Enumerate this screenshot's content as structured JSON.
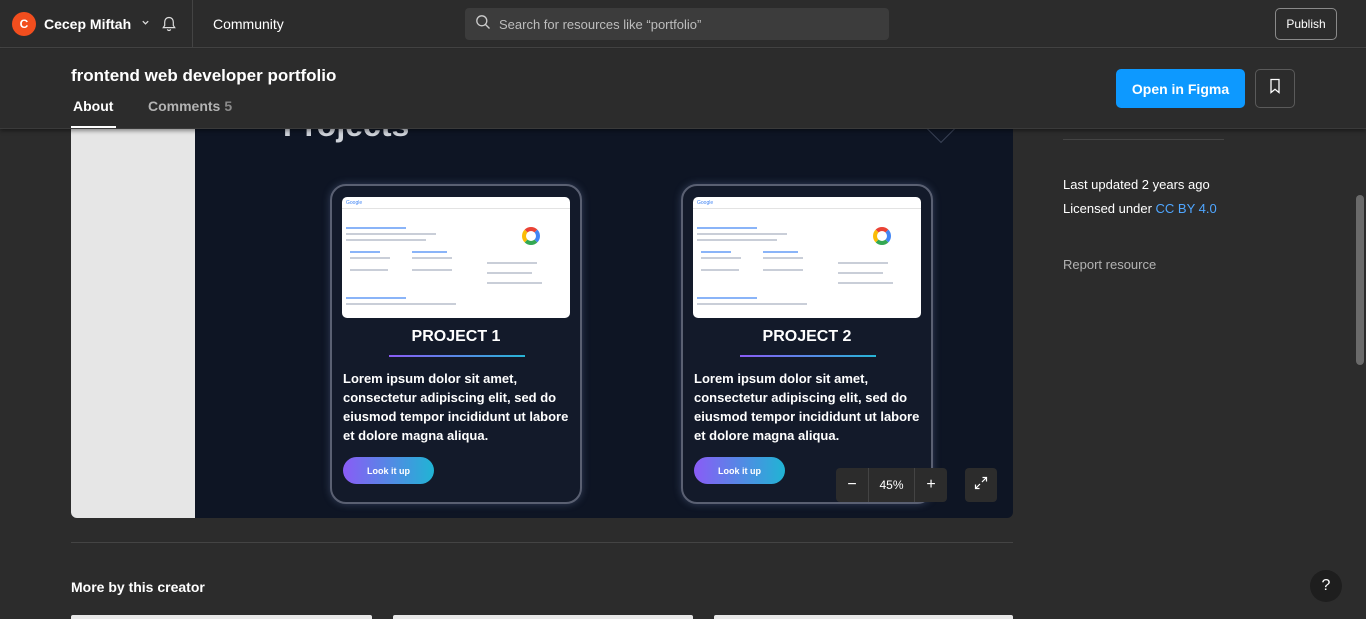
{
  "topbar": {
    "avatar_initial": "C",
    "username": "Cecep Miftah",
    "community_label": "Community",
    "search_placeholder": "Search for resources like “portfolio”",
    "publish_label": "Publish"
  },
  "header": {
    "title": "frontend web developer portfolio",
    "tabs": [
      {
        "label": "About",
        "active": true
      },
      {
        "label": "Comments",
        "count": "5",
        "active": false
      }
    ],
    "open_in_figma_label": "Open in Figma"
  },
  "preview": {
    "heading": "Projects",
    "cards": [
      {
        "title": "PROJECT 1",
        "description": "Lorem ipsum dolor sit amet, consectetur adipiscing elit, sed do eiusmod tempor incididunt ut labore et dolore magna aliqua.",
        "button_label": "Look it up",
        "screenshot_logo": "Google"
      },
      {
        "title": "PROJECT 2",
        "description": "Lorem ipsum dolor sit amet, consectetur adipiscing elit, sed do eiusmod tempor incididunt ut labore et dolore magna aliqua.",
        "button_label": "Look it up",
        "screenshot_logo": "Google"
      }
    ],
    "zoom": {
      "minus": "−",
      "value": "45%",
      "plus": "+"
    }
  },
  "sidebar": {
    "last_updated": "Last updated 2 years ago",
    "license_prefix": "Licensed under ",
    "license_link": "CC BY 4.0",
    "report_label": "Report resource"
  },
  "more_by_creator": "More by this creator",
  "help_label": "?",
  "colors": {
    "accent": "#0d99ff",
    "avatar": "#f24e1e",
    "link": "#4fa6ff",
    "background": "#2c2c2c"
  }
}
